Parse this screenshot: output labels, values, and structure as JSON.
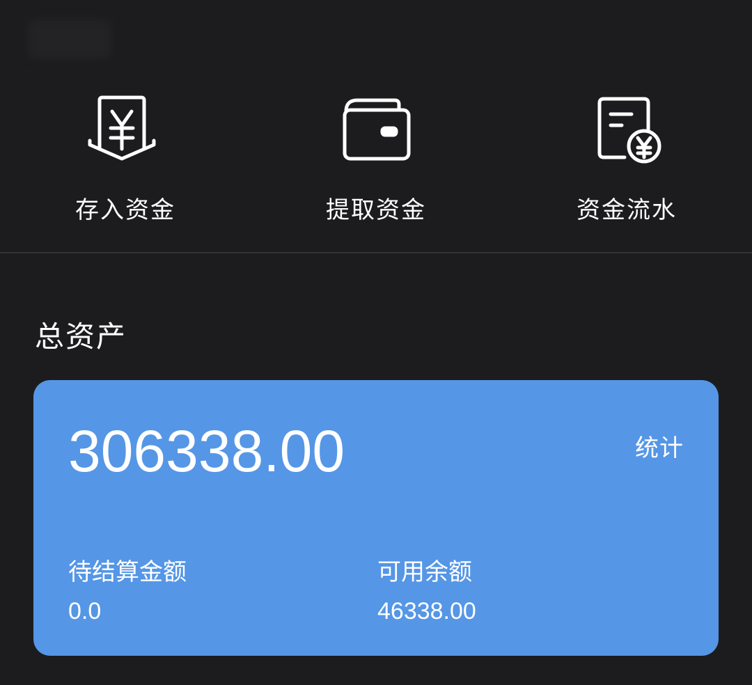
{
  "actions": [
    {
      "label": "存入资金",
      "icon": "deposit-yen-icon"
    },
    {
      "label": "提取资金",
      "icon": "wallet-icon"
    },
    {
      "label": "资金流水",
      "icon": "statement-yen-icon"
    }
  ],
  "assets": {
    "title": "总资产",
    "total": "306338.00",
    "stats_link": "统计",
    "pending_label": "待结算金额",
    "pending_value": "0.0",
    "available_label": "可用余额",
    "available_value": "46338.00"
  },
  "colors": {
    "background": "#1c1c1e",
    "card": "#5596e6",
    "divider": "#333336",
    "text": "#ffffff"
  }
}
